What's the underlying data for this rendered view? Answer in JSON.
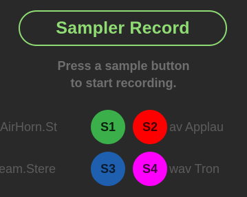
{
  "title": "Sampler Record",
  "instructions": {
    "line1": "Press a sample button",
    "line2": "to start recording."
  },
  "pads": [
    {
      "label": "S1",
      "color": "#3bb04a"
    },
    {
      "label": "S2",
      "color": "#ff0000"
    },
    {
      "label": "S3",
      "color": "#1f5faf"
    },
    {
      "label": "S4",
      "color": "#ff00ff"
    }
  ],
  "file_names": {
    "row1_left": "AirHorn.St",
    "row1_right": "av  Applau",
    "row2_left": "eam.Stere",
    "row2_right": "wav   Tron"
  },
  "colors": {
    "background": "#292929",
    "title_accent": "#8fdc74",
    "instruction_text": "#6f6f6f",
    "file_text": "#5c5c5c"
  }
}
